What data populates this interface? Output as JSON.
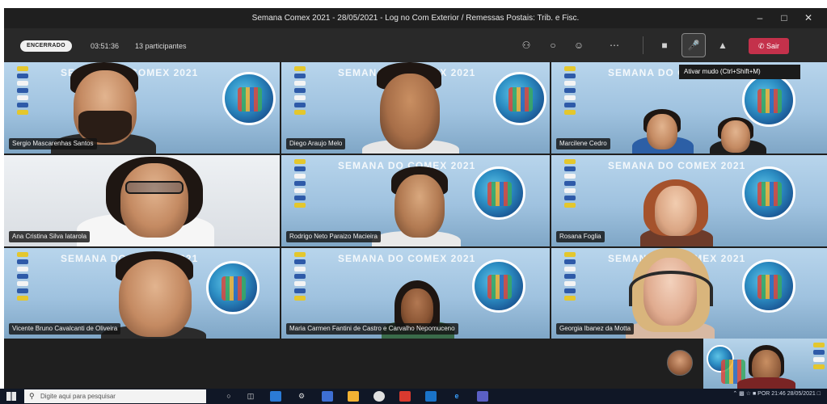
{
  "window": {
    "title": "Semana Comex 2021 - 28/05/2021 - Log no Com Exterior / Remessas Postais: Trib. e Fisc."
  },
  "toolbar": {
    "status_label": "ENCERRADO",
    "timer": "03:51:36",
    "participants": "13 participantes",
    "leave_label": "Sair",
    "mic_tooltip": "Ativar mudo (Ctrl+Shift+M)"
  },
  "tiles": [
    {
      "name": "Sergio Mascarenhas Santos",
      "banner": "SEMANA DO COMEX 2021"
    },
    {
      "name": "Diego Araujo Melo",
      "banner": "SEMANA DO COMEX 2021"
    },
    {
      "name": "Marcilene Cedro",
      "banner": "SEMANA DO COMEX 2021"
    },
    {
      "name": "Ana Cristina Silva Iatarola",
      "banner": ""
    },
    {
      "name": "Rodrigo Neto Paraizo Macieira",
      "banner": "SEMANA DO COMEX 2021"
    },
    {
      "name": "Rosana Foglia",
      "banner": "SEMANA DO COMEX 2021"
    },
    {
      "name": "Vicente Bruno Cavalcanti de Oliveira",
      "banner": "SEMANA DO COMEX 2021"
    },
    {
      "name": "Maria Carmen Fantini de Castro e Carvalho Nepomuceno",
      "banner": "SEMANA DO COMEX 2021"
    },
    {
      "name": "Georgia Ibanez da Motta",
      "banner": "SEMANA DO COMEX 2021"
    }
  ],
  "taskbar": {
    "search_placeholder": "Digite aqui para pesquisar",
    "language": "POR",
    "time": "21:46",
    "date": "28/05/2021"
  },
  "icons": [
    "participants-icon",
    "chat-icon",
    "reactions-icon",
    "more-icon",
    "camera-icon",
    "mic-icon",
    "share-icon",
    "phone-icon"
  ]
}
